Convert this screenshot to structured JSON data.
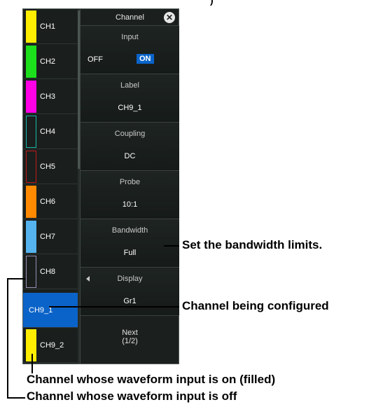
{
  "panel": {
    "title": "Channel",
    "channels": [
      {
        "label": "CH1",
        "color": "#ffee00",
        "filled": true
      },
      {
        "label": "CH2",
        "color": "#1de01d",
        "filled": true
      },
      {
        "label": "CH3",
        "color": "#ff00e6",
        "filled": true
      },
      {
        "label": "CH4",
        "color": "#19b7a8",
        "filled": false
      },
      {
        "label": "CH5",
        "color": "#c01818",
        "filled": false
      },
      {
        "label": "CH6",
        "color": "#ff8a00",
        "filled": true
      },
      {
        "label": "CH7",
        "color": "#55b3ee",
        "filled": true
      },
      {
        "label": "CH8",
        "color": "#9a8fb5",
        "filled": false
      },
      {
        "label": "CH9_1",
        "color": "#0a63c9",
        "filled": true,
        "selected": true
      },
      {
        "label": "CH9_2",
        "color": "#ffee00",
        "filled": true
      }
    ],
    "input": {
      "title": "Input",
      "off": "OFF",
      "on": "ON"
    },
    "label": {
      "title": "Label",
      "value": "CH9_1"
    },
    "coupling": {
      "title": "Coupling",
      "value": "DC"
    },
    "probe": {
      "title": "Probe",
      "value": "10:1"
    },
    "bandwidth": {
      "title": "Bandwidth",
      "value": "Full"
    },
    "display": {
      "title": "Display",
      "value": "Gr1"
    },
    "next": {
      "line1": "Next",
      "line2": "(1/2)"
    }
  },
  "callouts": {
    "bandwidth": "Set the bandwidth limits.",
    "configured": "Channel being configured",
    "input_on": "Channel whose waveform input is on (filled)",
    "input_off": "Channel whose waveform input is off"
  },
  "top_crop": ")"
}
